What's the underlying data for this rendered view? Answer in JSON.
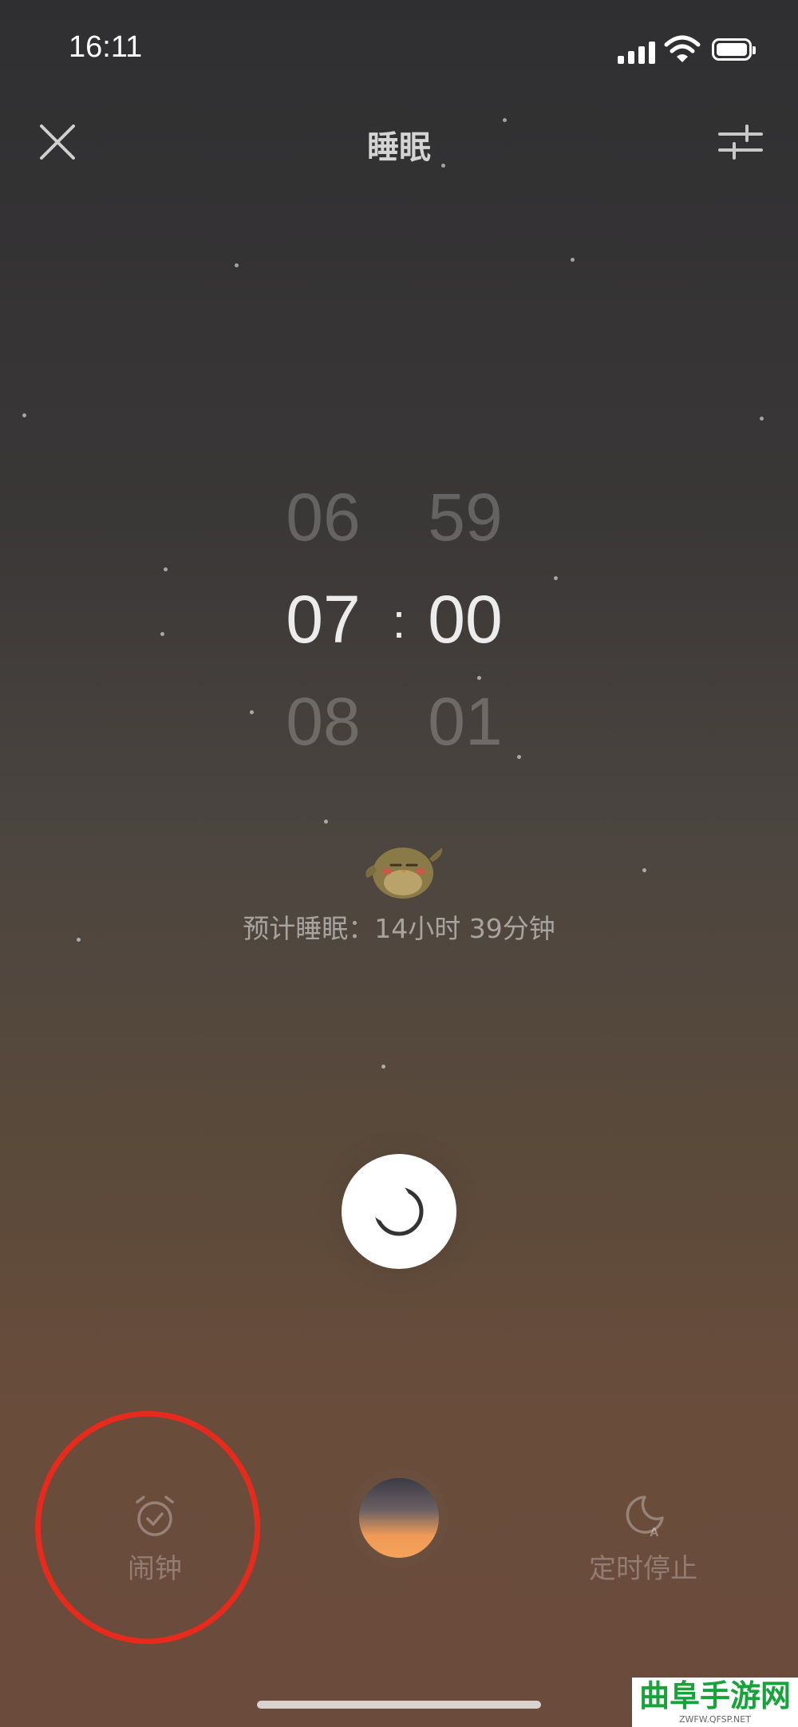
{
  "status_bar": {
    "time": "16:11"
  },
  "header": {
    "title": "睡眠"
  },
  "picker": {
    "hour_prev": "06",
    "hour_selected": "07",
    "hour_next": "08",
    "minute_prev": "59",
    "minute_selected": "00",
    "minute_next": "01",
    "separator": ":"
  },
  "estimate": "预计睡眠：14小时 39分钟",
  "toolbar": {
    "alarm_label": "闹钟",
    "timer_label": "定时停止"
  },
  "watermark": {
    "main": "曲阜手游网",
    "sub": "ZWFW.QFSP.NET"
  },
  "colors": {
    "annotation": "#e82a1c",
    "orb_orange": "#f7a259"
  },
  "icons": [
    "close-icon",
    "sliders-icon",
    "moon-icon",
    "alarm-clock-icon",
    "moon-timer-icon"
  ]
}
